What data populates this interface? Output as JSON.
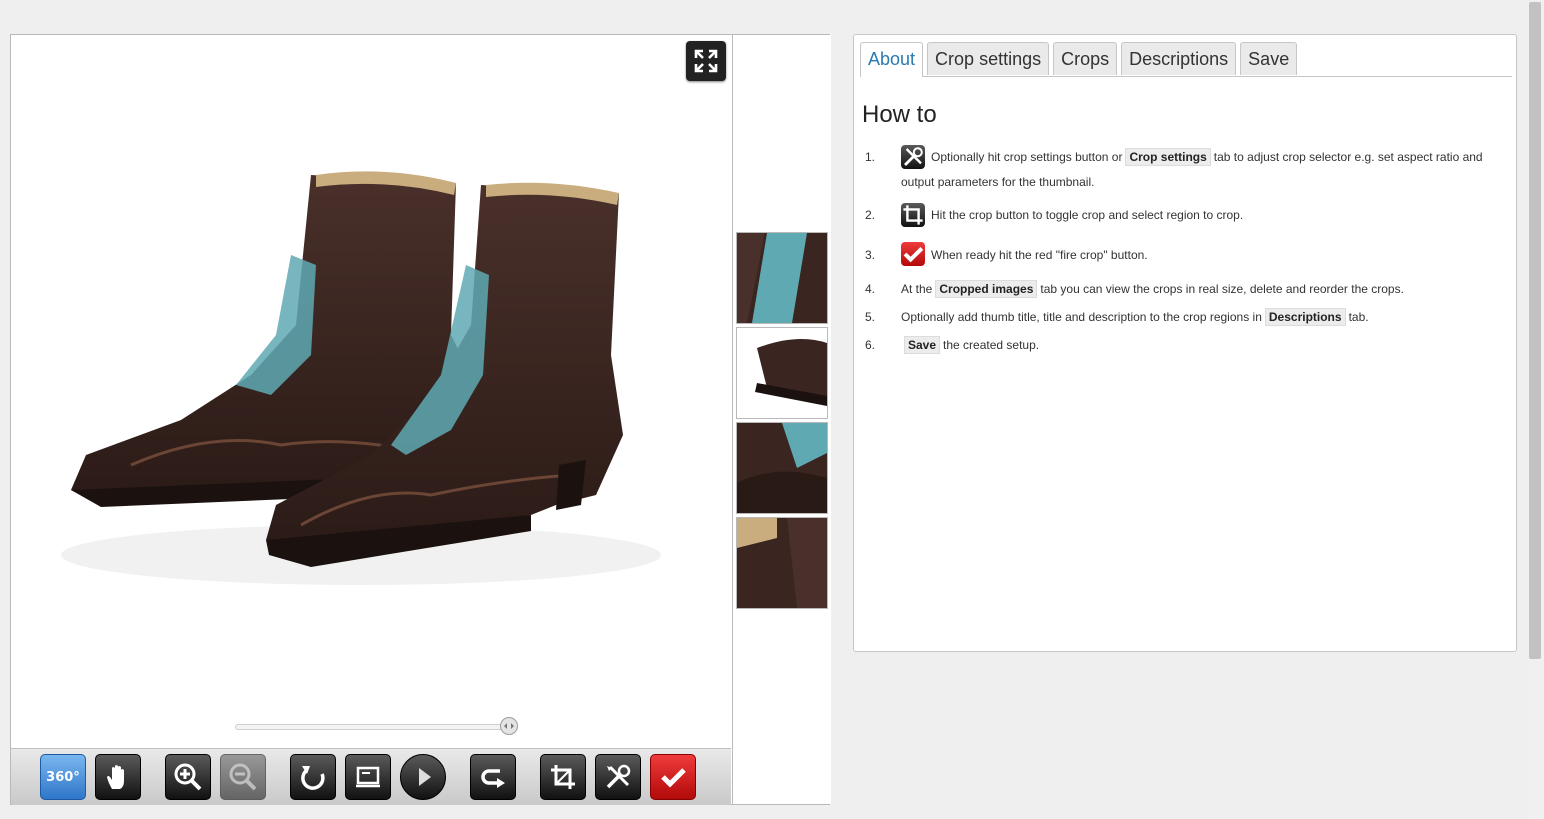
{
  "viewer": {
    "fullscreen_icon": "expand-icon",
    "slider": {
      "value": 1.0
    },
    "toolbar": [
      {
        "name": "rotate-360-button",
        "label": "360°",
        "icon": "360-icon",
        "style": "blue"
      },
      {
        "name": "pan-hand-button",
        "icon": "hand-icon"
      },
      {
        "name": "zoom-in-button",
        "icon": "zoom-in-icon"
      },
      {
        "name": "zoom-out-button",
        "icon": "zoom-out-icon",
        "disabled": true
      },
      {
        "name": "reset-button",
        "icon": "undo-icon"
      },
      {
        "name": "fit-screen-button",
        "icon": "screen-icon"
      },
      {
        "name": "play-button",
        "icon": "play-icon"
      },
      {
        "name": "next-button",
        "icon": "redo-icon"
      },
      {
        "name": "crop-button",
        "icon": "crop-icon"
      },
      {
        "name": "crop-settings-button",
        "icon": "tools-icon"
      },
      {
        "name": "fire-crop-button",
        "icon": "checkmark-icon",
        "style": "red"
      }
    ],
    "thumbnails": [
      "thumb-1",
      "thumb-2",
      "thumb-3",
      "thumb-4"
    ]
  },
  "panel": {
    "tabs": [
      "About",
      "Crop settings",
      "Crops",
      "Descriptions",
      "Save"
    ],
    "active_tab": "About",
    "heading": "How to",
    "steps": [
      {
        "num": "1.",
        "icon": "tools-icon",
        "pre": "Optionally hit crop settings button or",
        "chip": "Crop settings",
        "post": "tab to adjust crop selector e.g. set aspect ratio and output parameters for the thumbnail."
      },
      {
        "num": "2.",
        "icon": "crop-icon",
        "pre": "Hit the crop button to toggle crop and select region to crop."
      },
      {
        "num": "3.",
        "icon": "checkmark-icon",
        "pre": "When ready hit the red \"fire crop\" button."
      },
      {
        "num": "4.",
        "pre": "At the",
        "chip": "Cropped images",
        "post": "tab you can view the crops in real size, delete and reorder the crops."
      },
      {
        "num": "5.",
        "pre": "Optionally add thumb title, title and description to the crop regions in",
        "chip": "Descriptions",
        "post": "tab."
      },
      {
        "num": "6.",
        "chip": "Save",
        "post": "the created setup."
      }
    ]
  },
  "colors": {
    "accent_blue": "#2a7ab0",
    "fire_red": "#d11a1a",
    "boot_leather": "#3a2520",
    "boot_inlay": "#5fa9b3"
  }
}
